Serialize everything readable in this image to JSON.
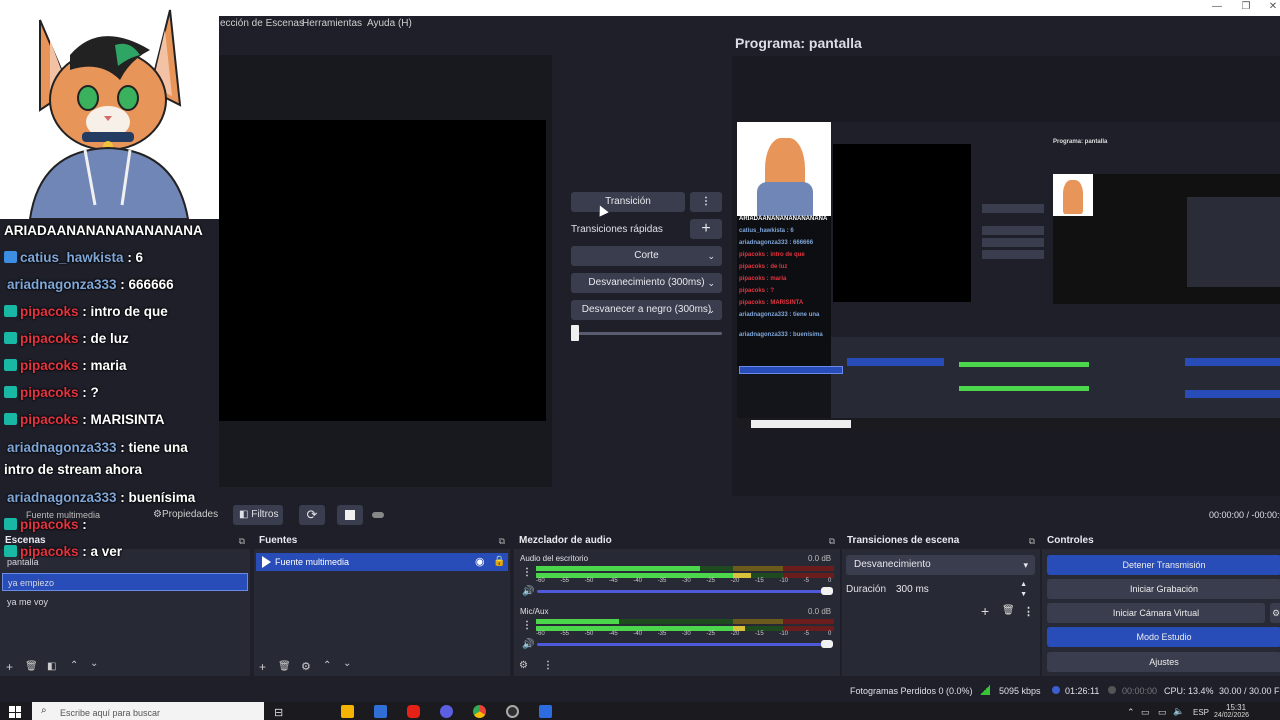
{
  "menu": {
    "items": [
      "ección de Escenas",
      "Herramientas",
      "Ayuda (H)"
    ]
  },
  "window_controls": [
    "—",
    "❐",
    "✕"
  ],
  "program": {
    "title": "Programa: pantalla"
  },
  "transition_panel": {
    "transition_button": "Transición",
    "quick_transitions_label": "Transiciones rápidas",
    "quick": [
      "Corte",
      "Desvanecimiento (300ms)",
      "Desvanecer a negro (300ms)"
    ]
  },
  "source_toolbar": {
    "label": "Fuente multimedia",
    "properties": "Propiedades",
    "filters": "Filtros",
    "time": "00:00:00  /  -00:00:0"
  },
  "scenes": {
    "title": "Escenas",
    "items": [
      "pantalla",
      "ya empiezo",
      "ya me voy"
    ],
    "selected_index": 1
  },
  "sources": {
    "title": "Fuentes",
    "items": [
      "Fuente multimedia"
    ]
  },
  "mixer": {
    "title": "Mezclador de audio",
    "channels": [
      {
        "name": "Audio del escritorio",
        "db": "0.0 dB",
        "level": 0.55,
        "level2": 0.72
      },
      {
        "name": "Mic/Aux",
        "db": "0.0 dB",
        "level": 0.28,
        "level2": 0.7
      }
    ],
    "ticks": [
      "-60",
      "-55",
      "-50",
      "-45",
      "-40",
      "-35",
      "-30",
      "-25",
      "-20",
      "-15",
      "-10",
      "-5",
      "0"
    ]
  },
  "scene_transitions": {
    "title": "Transiciones de escena",
    "selected": "Desvanecimiento",
    "duration_label": "Duración",
    "duration_value": "300 ms"
  },
  "controls": {
    "title": "Controles",
    "buttons": [
      "Detener Transmisión",
      "Iniciar Grabación",
      "Iniciar Cámara Virtual",
      "Modo Estudio",
      "Ajustes"
    ]
  },
  "status": {
    "dropped": "Fotogramas Perdidos 0 (0.0%)",
    "bitrate": "5095 kbps",
    "live_time": "01:26:11",
    "rec_time": "00:00:00",
    "cpu": "CPU: 13.4%",
    "fps": "30.00 / 30.00 FP"
  },
  "taskbar": {
    "search_placeholder": "Escribe aquí para buscar",
    "lang": "ESP",
    "time": "15:31",
    "date": "24/02/2026"
  },
  "chat": {
    "header": "ARIADAANANANANANANANA",
    "messages": [
      {
        "user": "catius_hawkista",
        "text": ": 6",
        "color": "blue",
        "badge": "blue"
      },
      {
        "user": "ariadnagonza333",
        "text": ": 666666",
        "color": "blue",
        "badge": ""
      },
      {
        "user": "pipacoks",
        "text": ": intro de que",
        "color": "red",
        "badge": "teal"
      },
      {
        "user": "pipacoks",
        "text": ": de luz",
        "color": "red",
        "badge": "teal"
      },
      {
        "user": "pipacoks",
        "text": ": maria",
        "color": "red",
        "badge": "teal"
      },
      {
        "user": "pipacoks",
        "text": ": ?",
        "color": "red",
        "badge": "teal"
      },
      {
        "user": "pipacoks",
        "text": ": MARISINTA",
        "color": "red",
        "badge": "teal"
      },
      {
        "user": "ariadnagonza333",
        "text": ": tiene una",
        "color": "blue",
        "badge": ""
      },
      {
        "user": "",
        "text": "intro de stream ahora",
        "color": "",
        "badge": ""
      },
      {
        "user": "ariadnagonza333",
        "text": ": buenísima",
        "color": "blue",
        "badge": ""
      },
      {
        "user": "pipacoks",
        "text": ":",
        "color": "red",
        "badge": "teal"
      },
      {
        "user": "pipacoks",
        "text": ": a ver",
        "color": "red",
        "badge": "teal"
      }
    ]
  },
  "colors": {
    "accent": "#284cb8",
    "bg": "#1e1f29",
    "dock": "#272934",
    "meter_green": "#4cd64c"
  }
}
